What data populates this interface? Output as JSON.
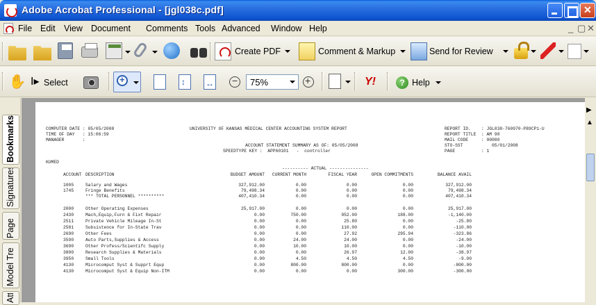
{
  "window": {
    "title": "Adobe Acrobat Professional - [jgl038c.pdf]"
  },
  "menu": {
    "items": [
      "File",
      "Edit",
      "View",
      "Document",
      "Comments",
      "Tools",
      "Advanced",
      "Window",
      "Help"
    ]
  },
  "toolbar1": {
    "create_pdf": "Create PDF",
    "comment_markup": "Comment & Markup",
    "send_for_review": "Send for Review"
  },
  "toolbar2": {
    "select_label": "Select",
    "zoom_value": "75%",
    "help_label": "Help"
  },
  "nav_tabs": [
    "Bookmarks",
    "Signatures",
    "Pages",
    "Model Tree",
    "Attachments"
  ],
  "report": {
    "computer_date": "COMPUTER DATE : 05/05/2008",
    "time_of_day": "TIME OF DAY   : 15:06:59",
    "manager": "MANAGER       :",
    "heading": "UNIVERSITY OF KANSAS MEDICAL CENTER ACCOUNTING SYSTEM REPORT",
    "report_id": "REPORT ID.    : JGL038-760970-P89CP1-U",
    "report_title": "REPORT TITLE  : AM 90",
    "mail_code": "MAIL CODE     : 00080",
    "sto_sst": "STO-SST           05/01/2008",
    "page": "PAGE          : 1",
    "statement": "ACCOUNT STATEMENT SUMMARY AS OF: 05/05/2008",
    "speedtype": "SPEEDTYPE KEY :  APP60101   -  controller",
    "unit": "KUMED",
    "actual_header": "---------- ACTUAL ---------------",
    "columns": [
      "ACCOUNT",
      "DESCRIPTION",
      "BUDGET AMOUNT",
      "CURRENT MONTH",
      "FISCAL YEAR",
      "OPEN COMMITMENTS",
      "BALANCE AVAIL"
    ],
    "group1": [
      [
        "1005",
        "Salary and Wages",
        "327,912.00",
        "0.00",
        "0.00",
        "0.00",
        "327,912.00"
      ],
      [
        "1745",
        "Fringe Benefits",
        "79,498.34",
        "0.00",
        "0.00",
        "0.00",
        "79,498.34"
      ],
      [
        "",
        "*** TOTAL PERSONNEL **********",
        "407,410.34",
        "0.00",
        "0.00",
        "0.00",
        "407,410.34"
      ]
    ],
    "group2": [
      [
        "2000",
        "Other Operating Expenses",
        "25,917.00",
        "0.00",
        "0.00",
        "0.00",
        "25,917.00"
      ],
      [
        "2430",
        "Mach,Equip,Furn & Fixt Repair",
        "0.00",
        "750.00",
        "952.00",
        "188.00",
        "-1,140.00"
      ],
      [
        "2511",
        "Private Vehicle Mileage In-St",
        "0.00",
        "0.00",
        "25.80",
        "0.00",
        "-25.80"
      ],
      [
        "2581",
        "Subsistence for In-State Trav",
        "0.00",
        "0.00",
        "110.00",
        "0.00",
        "-110.00"
      ],
      [
        "2690",
        "Other Fees",
        "0.00",
        "0.00",
        "27.92",
        "295.94",
        "-323.86"
      ],
      [
        "3590",
        "Auto Parts,Supplies & Access",
        "0.00",
        "24.00",
        "24.00",
        "0.00",
        "-24.00"
      ],
      [
        "3690",
        "Other Profess/Scientifc Supply",
        "0.00",
        "10.00",
        "10.00",
        "0.00",
        "-10.00"
      ],
      [
        "3800",
        "Research Supplies & Materials",
        "0.00",
        "0.00",
        "26.97",
        "12.00",
        "-38.97"
      ],
      [
        "3950",
        "Small Tools",
        "0.00",
        "4.50",
        "4.50",
        "4.50",
        "-9.00"
      ],
      [
        "4130",
        "Microcomput Syst & Supprt Equp",
        "0.00",
        "800.00",
        "800.00",
        "0.00",
        "-800.00"
      ],
      [
        "4130",
        "Microcomput Syst & Equip Non-ITM",
        "0.00",
        "0.00",
        "0.00",
        "300.00",
        "-300.00"
      ]
    ]
  }
}
